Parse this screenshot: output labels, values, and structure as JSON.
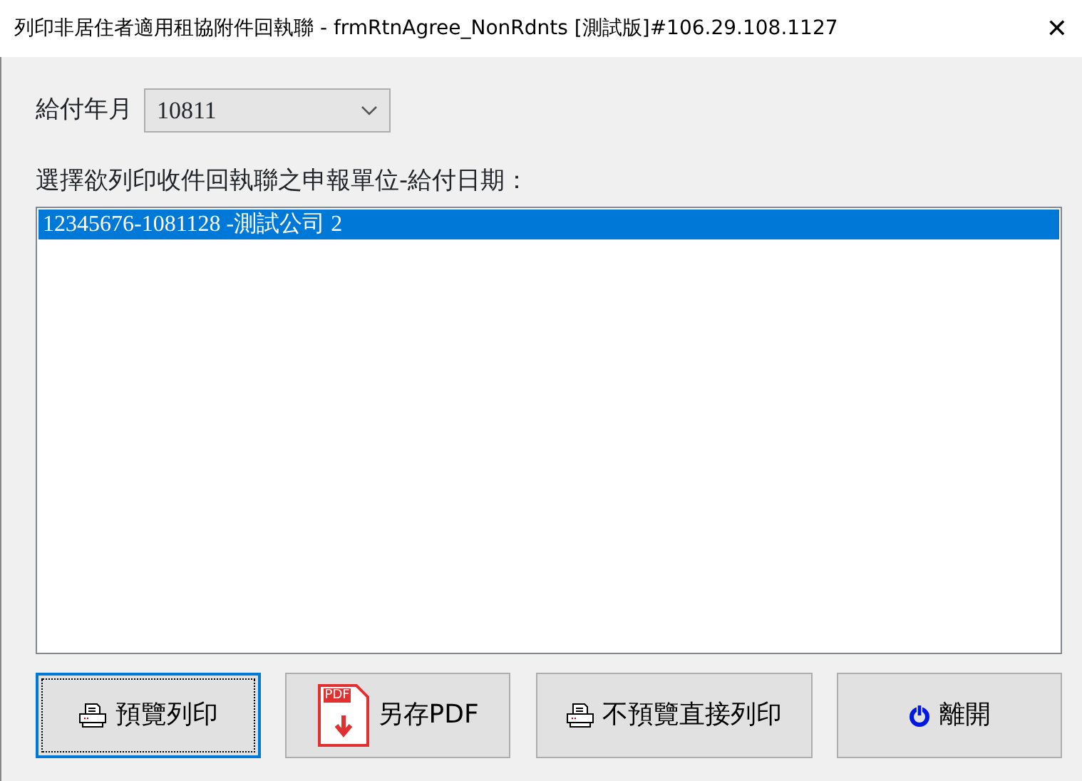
{
  "window": {
    "title": "列印非居住者適用租協附件回執聯 - frmRtnAgree_NonRdnts [測試版]#106.29.108.1127",
    "close": "✕"
  },
  "pay_month": {
    "label": "給付年月",
    "value": "10811"
  },
  "list": {
    "label": "選擇欲列印收件回執聯之申報單位-給付日期：",
    "items": [
      {
        "text": "12345676-1081128 -測試公司 2",
        "selected": true
      }
    ]
  },
  "buttons": [
    {
      "label": "預覽列印",
      "kind": "printer",
      "focused": true
    },
    {
      "label": "另存PDF",
      "kind": "pdf",
      "icon_text": "PDF",
      "focused": false
    },
    {
      "label": "不預覽直接列印",
      "kind": "printer",
      "focused": false
    },
    {
      "label": "離開",
      "kind": "power",
      "focused": false
    }
  ]
}
